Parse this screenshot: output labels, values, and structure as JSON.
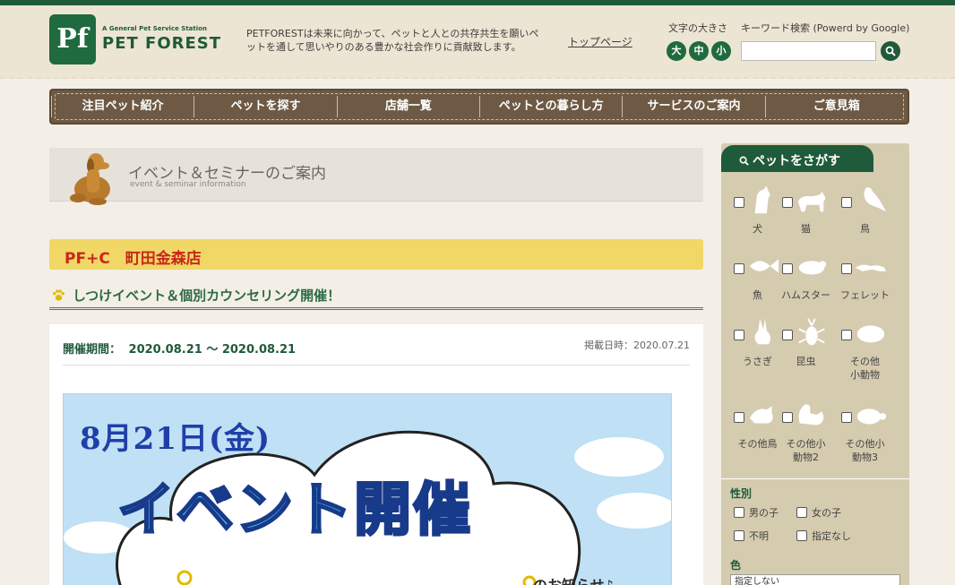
{
  "header": {
    "logo_mark": "Pf",
    "logo_small": "A General Pet Service Station",
    "logo_text": "PET FOREST",
    "tagline": "PETFORESTは未来に向かって、ペットと人との共存共生を願いペットを通して思いやりのある豊かな社会作りに貢献致します。",
    "toppage_link": "トップページ",
    "fontsize_label": "文字の大きさ",
    "fontsize_buttons": [
      "大",
      "中",
      "小"
    ],
    "search_label": "キーワード検索 (Powerd by Google)",
    "search_placeholder": "",
    "search_icon_glyph": "🔍"
  },
  "nav": {
    "items": [
      "注目ペット紹介",
      "ペットを探す",
      "店舗一覧",
      "ペットとの暮らし方",
      "サービスのご案内",
      "ご意見箱"
    ]
  },
  "banner": {
    "title": "イベント＆セミナーのご案内",
    "subtitle": "event & seminar information"
  },
  "store": {
    "name": "PF+C　町田金森店"
  },
  "event": {
    "title": "しつけイベント＆個別カウンセリング開催！",
    "period_label": "開催期間：",
    "period_value": "2020.08.21 ～ 2020.08.21",
    "posted": "掲載日時：2020.07.21",
    "flyer": {
      "date": "8月21日(金)",
      "headline": "イベント開催",
      "notice": "のお知らせ♪"
    }
  },
  "sidebar": {
    "tab_label": "ペットをさがす",
    "pets": [
      {
        "label": "犬",
        "icon": "dog-icon"
      },
      {
        "label": "猫",
        "icon": "cat-icon"
      },
      {
        "label": "鳥",
        "icon": "bird-icon"
      },
      {
        "label": "魚",
        "icon": "fish-icon"
      },
      {
        "label": "ハムスター",
        "icon": "hamster-icon"
      },
      {
        "label": "フェレット",
        "icon": "ferret-icon"
      },
      {
        "label": "うさぎ",
        "icon": "rabbit-icon"
      },
      {
        "label": "昆虫",
        "icon": "insect-icon"
      },
      {
        "label": "その他小動物",
        "icon": "small-animal-icon"
      },
      {
        "label": "その他鳥",
        "icon": "other-bird-icon"
      },
      {
        "label": "その他小動物2",
        "icon": "squirrel-icon"
      },
      {
        "label": "その他小動物3",
        "icon": "turtle-icon"
      }
    ],
    "gender_heading": "性別",
    "gender_options": [
      "男の子",
      "女の子",
      "不明",
      "指定なし"
    ],
    "color_heading": "色",
    "color_value": "指定しない"
  },
  "colors": {
    "primary_green": "#1f5a3a",
    "nav_brown": "#6e5a44",
    "store_bar_yellow": "#f0d766",
    "store_name_red": "#c9271b",
    "sidebar_beige": "#d5cbaf"
  }
}
